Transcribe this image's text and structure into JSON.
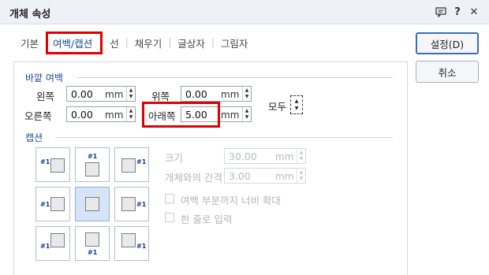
{
  "window": {
    "title": "개체 속성",
    "help_icon_label": "?",
    "close_icon_label": "✕"
  },
  "tabs": [
    {
      "label": "기본"
    },
    {
      "label": "여백/캡션"
    },
    {
      "label": "선"
    },
    {
      "label": "채우기"
    },
    {
      "label": "글상자"
    },
    {
      "label": "그림자"
    }
  ],
  "outer_margin": {
    "title": "바깥 여백",
    "left": {
      "label": "왼쪽",
      "value": "0.00",
      "unit": "mm"
    },
    "top": {
      "label": "위쪽",
      "value": "0.00",
      "unit": "mm"
    },
    "right": {
      "label": "오른쪽",
      "value": "0.00",
      "unit": "mm"
    },
    "bottom": {
      "label": "아래쪽",
      "value": "5.00",
      "unit": "mm"
    },
    "all_label": "모두"
  },
  "caption": {
    "title": "캡션",
    "tag": "#1",
    "size": {
      "label": "크기",
      "value": "30.00",
      "unit": "mm"
    },
    "gap": {
      "label": "개체와의 간격",
      "value": "3.00",
      "unit": "mm"
    },
    "extend_check": {
      "label": "여백 부분까지 너비 확대",
      "checked": false
    },
    "single_line_check": {
      "label": "한 줄로 입력",
      "checked": false
    }
  },
  "buttons": {
    "ok": "설정(D)",
    "cancel": "취소"
  },
  "colors": {
    "accent": "#1a4aa0",
    "highlight": "#e00000",
    "selected_bg": "#d6e4f7"
  }
}
